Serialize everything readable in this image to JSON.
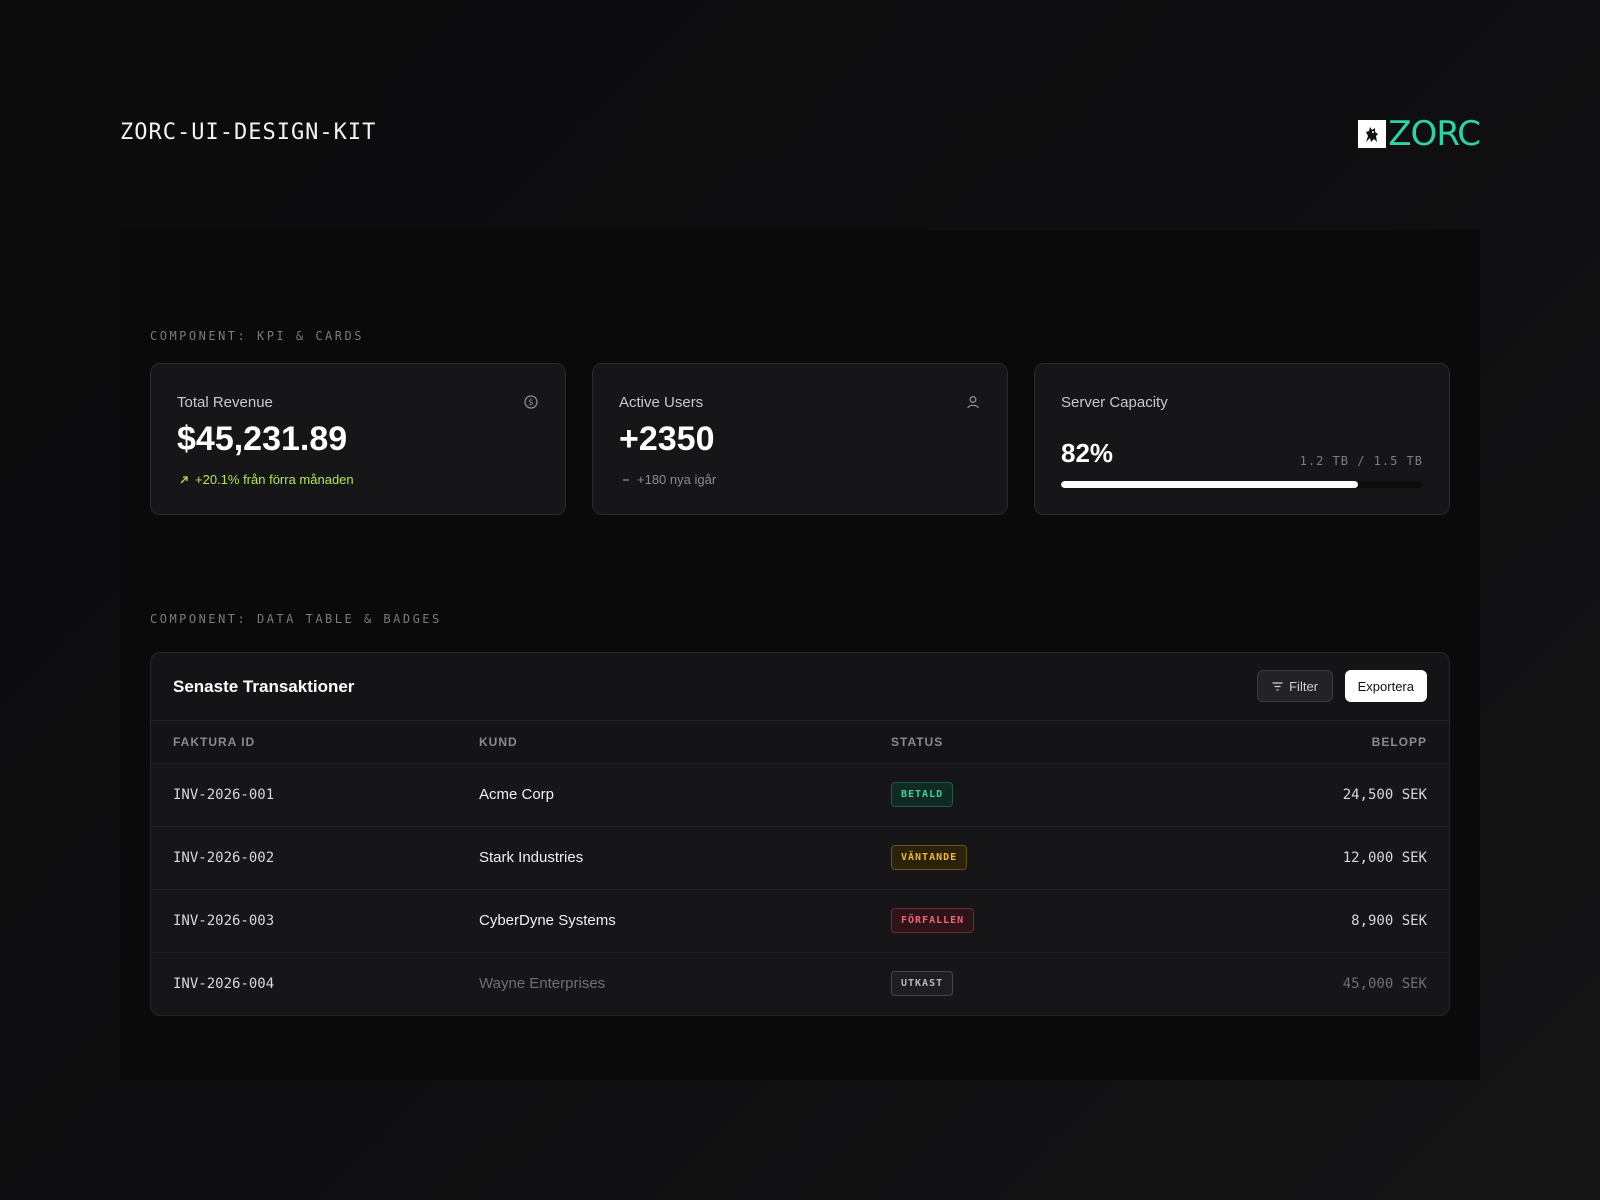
{
  "kit_title": "ZORC-UI-DESIGN-KIT",
  "logo": {
    "text": "ZORC",
    "color": "#2fd3a3"
  },
  "sections": {
    "kpi_label": "COMPONENT: KPI & CARDS",
    "table_label": "COMPONENT: DATA TABLE & BADGES"
  },
  "cards": {
    "revenue": {
      "title": "Total Revenue",
      "value": "$45,231.89",
      "trend_icon": "arrow-up-right-icon",
      "sub": "+20.1% från förra månaden",
      "icon": "dollar-circle-icon"
    },
    "users": {
      "title": "Active Users",
      "value": "+2350",
      "trend_icon": "minus-icon",
      "sub": "+180 nya igår",
      "icon": "user-icon"
    },
    "capacity": {
      "title": "Server Capacity",
      "value": "82%",
      "meta": "1.2 TB / 1.5 TB",
      "fill_percent": 82
    }
  },
  "table": {
    "title": "Senaste Transaktioner",
    "filter_label": "Filter",
    "export_label": "Exportera",
    "columns": [
      "FAKTURA ID",
      "KUND",
      "STATUS",
      "BELOPP"
    ],
    "rows": [
      {
        "id": "INV-2026-001",
        "kund": "Acme Corp",
        "status": "BETALD",
        "amount": "24,500 SEK",
        "muted": false,
        "badge": {
          "fg": "#3fd29a",
          "bg": "#0f2a22",
          "border": "#1f5a45"
        }
      },
      {
        "id": "INV-2026-002",
        "kund": "Stark Industries",
        "status": "VÄNTANDE",
        "amount": "12,000 SEK",
        "muted": false,
        "badge": {
          "fg": "#f2b833",
          "bg": "#2b220c",
          "border": "#6a5216"
        }
      },
      {
        "id": "INV-2026-003",
        "kund": "CyberDyne Systems",
        "status": "FÖRFALLEN",
        "amount": "8,900 SEK",
        "muted": false,
        "badge": {
          "fg": "#f0637a",
          "bg": "#2e1419",
          "border": "#6b2a35"
        }
      },
      {
        "id": "INV-2026-004",
        "kund": "Wayne Enterprises",
        "status": "UTKAST",
        "amount": "45,000 SEK",
        "muted": true,
        "badge": {
          "fg": "#b8b8bc",
          "bg": "#1e1e21",
          "border": "#45454a"
        }
      }
    ]
  }
}
